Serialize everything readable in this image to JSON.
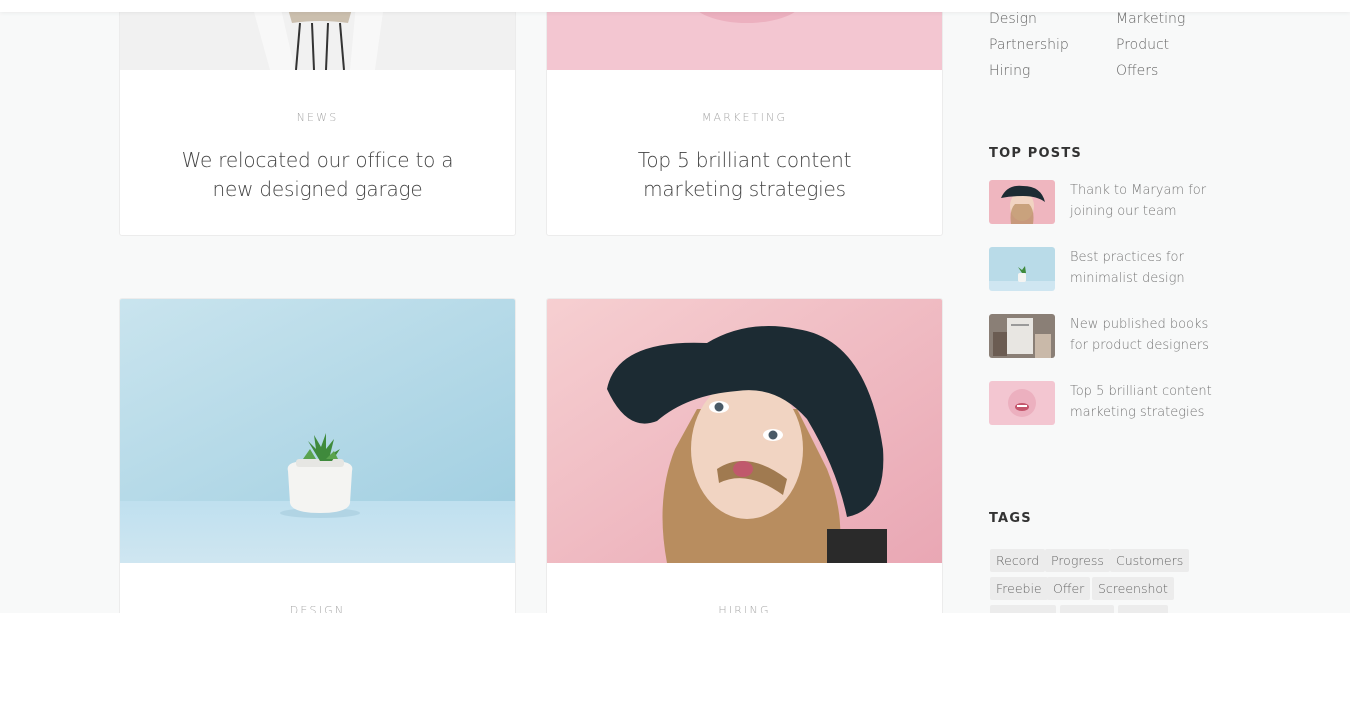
{
  "posts": [
    {
      "category": "News",
      "title": "We relocated our office to a new designed garage"
    },
    {
      "category": "Marketing",
      "title": "Top 5 brilliant content marketing strategies"
    },
    {
      "category": "Design",
      "title": ""
    },
    {
      "category": "Hiring",
      "title": ""
    }
  ],
  "sidebar": {
    "categories": [
      "Design",
      "Marketing",
      "Partnership",
      "Product",
      "Hiring",
      "Offers"
    ],
    "top_posts_title": "Top Posts",
    "top_posts": [
      {
        "title": "Thank to Maryam for joining our team",
        "thumb": "woman-hat-thumb"
      },
      {
        "title": "Best practices for minimalist design",
        "thumb": "plant-thumb"
      },
      {
        "title": "New published books for product designers",
        "thumb": "book-thumb"
      },
      {
        "title": "Top 5 brilliant content marketing strategies",
        "thumb": "lips-thumb"
      }
    ],
    "tags_title": "Tags",
    "tags": [
      "Record",
      "Progress",
      "Customers",
      "Freebie",
      "Offer",
      "Screenshot"
    ]
  },
  "colors": {
    "page_bg": "#f8f9f9",
    "card_bg": "#ffffff",
    "tag_bg": "#ececec",
    "pink_bg": "#f4c5cd",
    "blue_bg": "#bcdde9"
  }
}
